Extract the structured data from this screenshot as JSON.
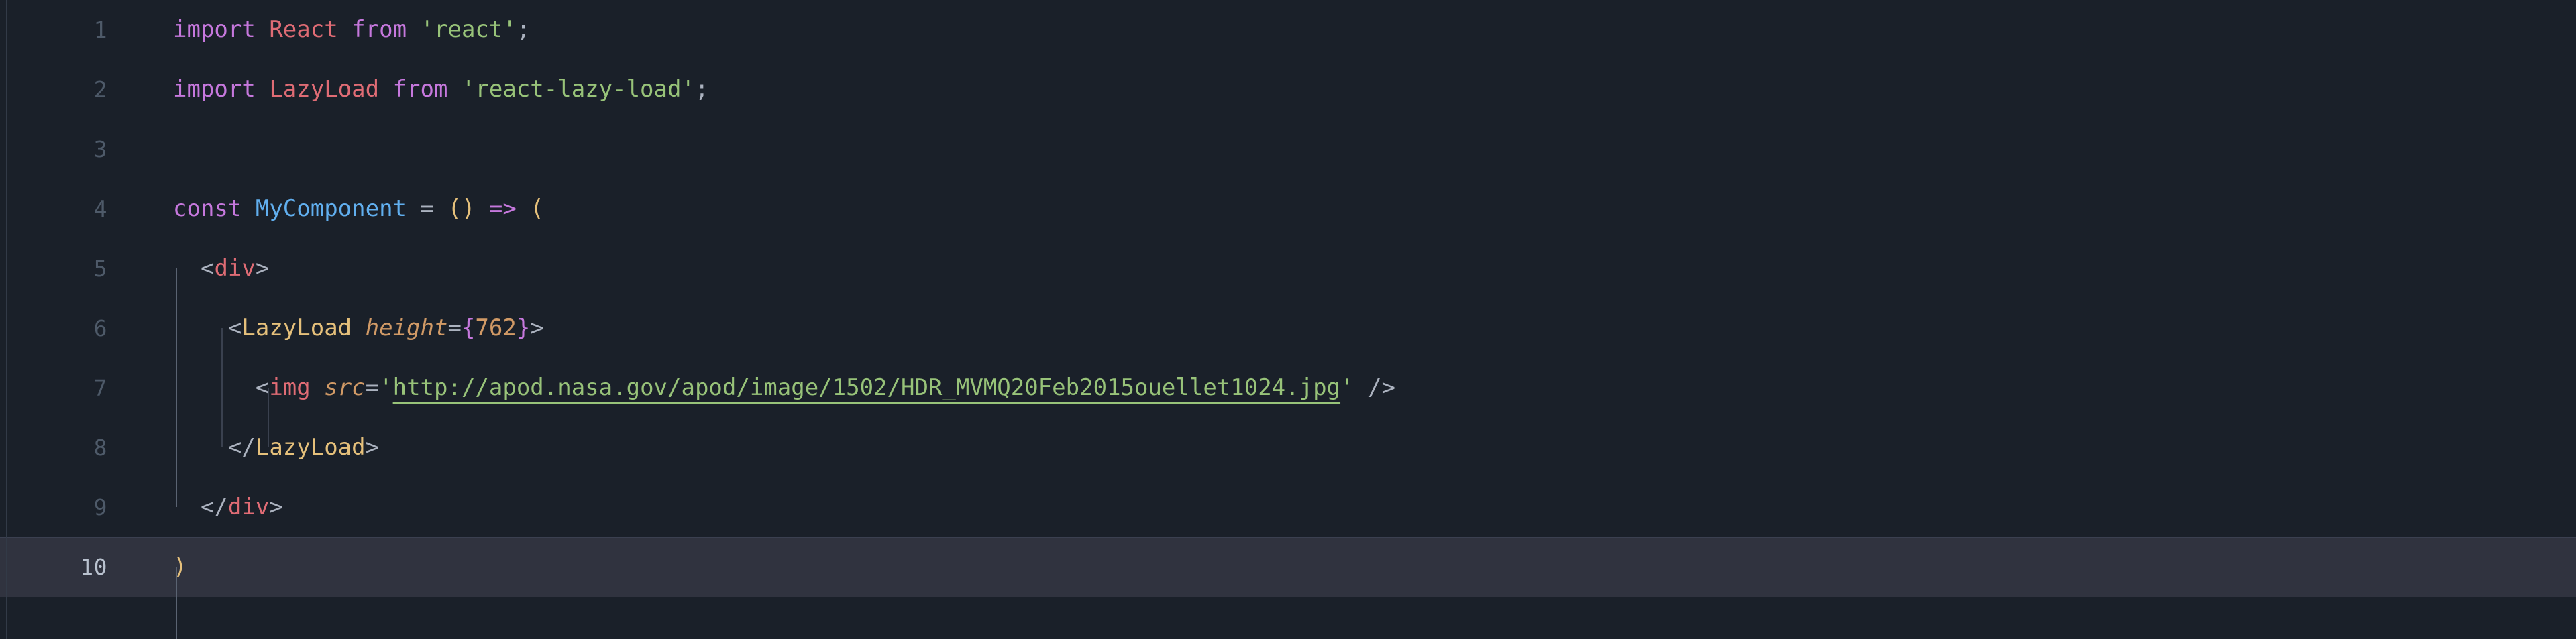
{
  "editor": {
    "theme_name": "one-dark",
    "language": "jsx",
    "background_color": "#1a2029",
    "active_line_color": "#30333f",
    "gutter_color": "#4e5a69",
    "active_gutter_color": "#b9c2cf",
    "active_line_number": 10,
    "total_lines": 10,
    "indent_size": 2,
    "colors": {
      "keyword": "#c678dd",
      "class": "#e06c75",
      "function": "#61afef",
      "string": "#98c379",
      "tag": "#e5c07b",
      "attribute": "#d19a66",
      "number": "#d19a66",
      "punctuation": "#abb2bf",
      "bracket_yellow": "#e5c07b",
      "indent_guide": "#3a414f",
      "indent_guide_active": "#5a6372"
    }
  },
  "gutter": {
    "numbers": [
      "1",
      "2",
      "3",
      "4",
      "5",
      "6",
      "7",
      "8",
      "9",
      "10"
    ]
  },
  "code": {
    "line1": {
      "kw_import": "import",
      "sp1": " ",
      "cls_react": "React",
      "sp2": " ",
      "kw_from": "from",
      "sp3": " ",
      "str_react": "'react'",
      "semi": ";"
    },
    "line2": {
      "kw_import": "import",
      "sp1": " ",
      "cls_lazyload": "LazyLoad",
      "sp2": " ",
      "kw_from": "from",
      "sp3": " ",
      "str_pkg": "'react-lazy-load'",
      "semi": ";"
    },
    "line3": {
      "empty": ""
    },
    "line4": {
      "kw_const": "const",
      "sp1": " ",
      "fn_name": "MyComponent",
      "sp2": " ",
      "eq": "=",
      "sp3": " ",
      "parens": "()",
      "sp4": " ",
      "arrow": "=>",
      "sp5": " ",
      "open_paren": "("
    },
    "line5": {
      "indent": "  ",
      "lt": "<",
      "tag": "div",
      "gt": ">"
    },
    "line6": {
      "indent": "    ",
      "lt": "<",
      "tag": "LazyLoad",
      "sp": " ",
      "attr": "height",
      "eq": "=",
      "brace_open": "{",
      "num": "762",
      "brace_close": "}",
      "gt": ">"
    },
    "line7": {
      "indent": "      ",
      "lt": "<",
      "tag": "img",
      "sp": " ",
      "attr": "src",
      "eq": "=",
      "quote_open": "'",
      "url": "http://apod.nasa.gov/apod/image/1502/HDR_MVMQ20Feb2015ouellet1024.jpg",
      "quote_close": "'",
      "sp2": " ",
      "selfclose": "/>"
    },
    "line8": {
      "indent": "    ",
      "lt": "</",
      "tag": "LazyLoad",
      "gt": ">"
    },
    "line9": {
      "indent": "  ",
      "lt": "</",
      "tag": "div",
      "gt": ">"
    },
    "line10": {
      "close_paren": ")"
    }
  }
}
